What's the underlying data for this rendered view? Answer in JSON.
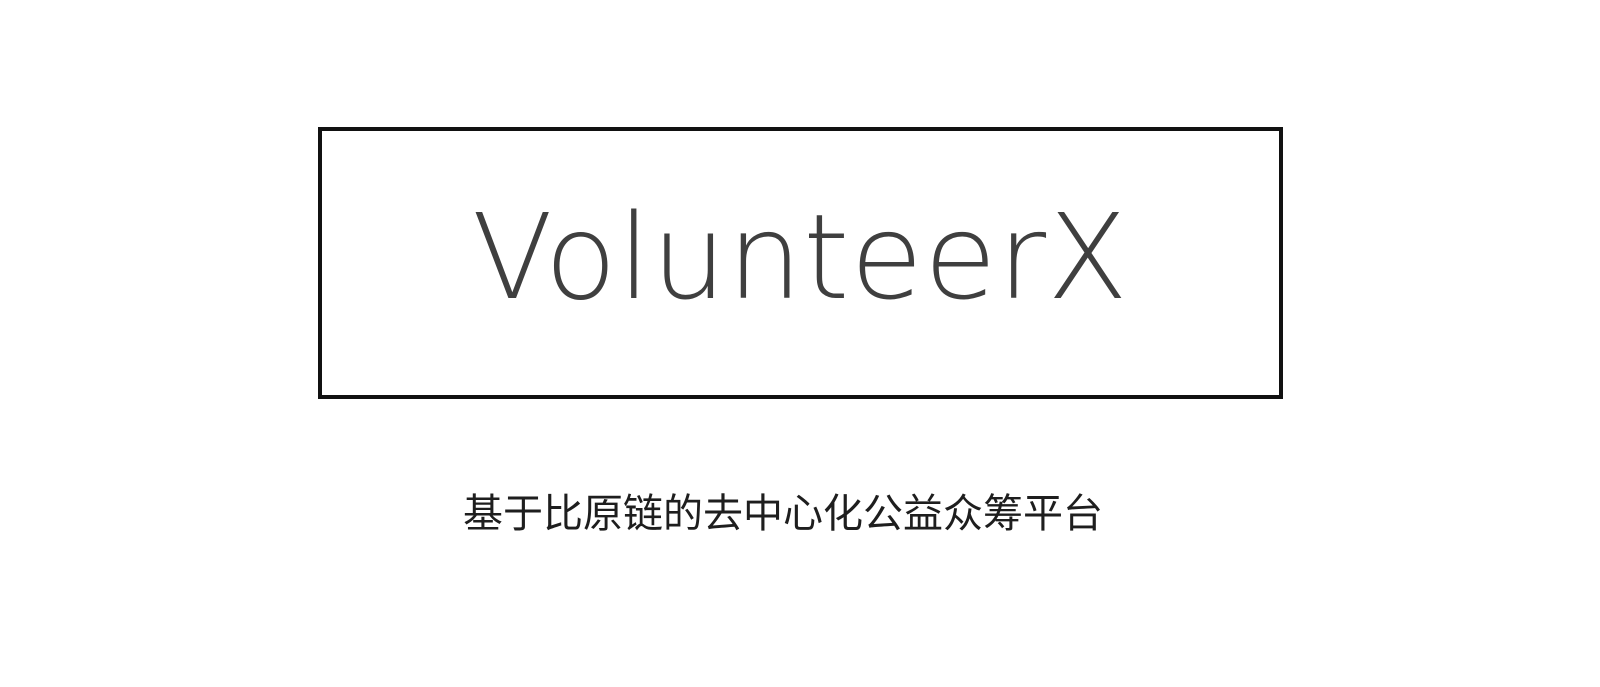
{
  "brand": {
    "name": "VolunteerX"
  },
  "tagline": "基于比原链的去中心化公益众筹平台",
  "colors": {
    "background": "#ffffff",
    "border": "#111111",
    "logo_text": "#3f3f3f",
    "tagline_text": "#1e1e1e"
  }
}
